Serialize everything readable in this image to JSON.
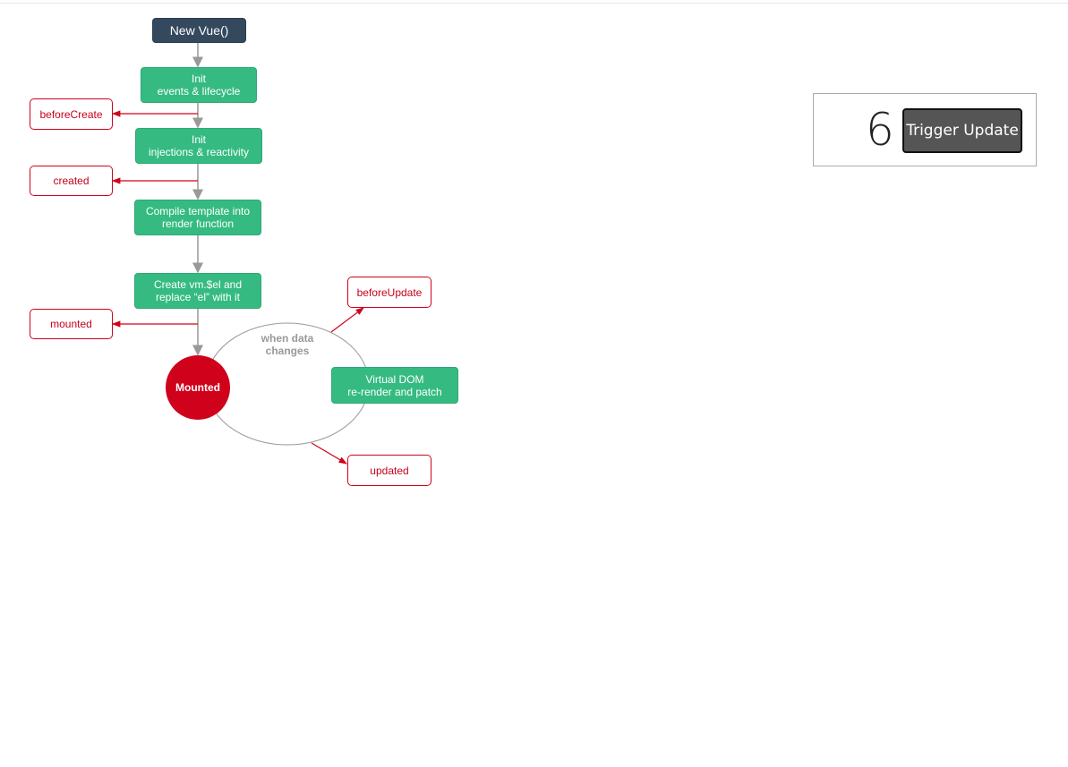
{
  "diagram": {
    "start": "New Vue()",
    "steps": [
      {
        "line1": "Init",
        "line2": "events & lifecycle"
      },
      {
        "line1": "Init",
        "line2": "injections & reactivity"
      },
      {
        "line1": "Compile template into",
        "line2": "render function"
      },
      {
        "line1": "Create vm.$el and",
        "line2": "replace “el” with it"
      }
    ],
    "hooks": {
      "beforeCreate": "beforeCreate",
      "created": "created",
      "mounted": "mounted",
      "beforeUpdate": "beforeUpdate",
      "updated": "updated"
    },
    "mounted_state": "Mounted",
    "loop_label_1": "when data",
    "loop_label_2": "changes",
    "virtual_dom": {
      "line1": "Virtual DOM",
      "line2": "re-render and patch"
    },
    "colors": {
      "green": "#35bb81",
      "dark": "#34495e",
      "red": "#d0021b",
      "gray": "#999999"
    }
  },
  "counter": {
    "value": "6",
    "button_label": "Trigger Update"
  }
}
